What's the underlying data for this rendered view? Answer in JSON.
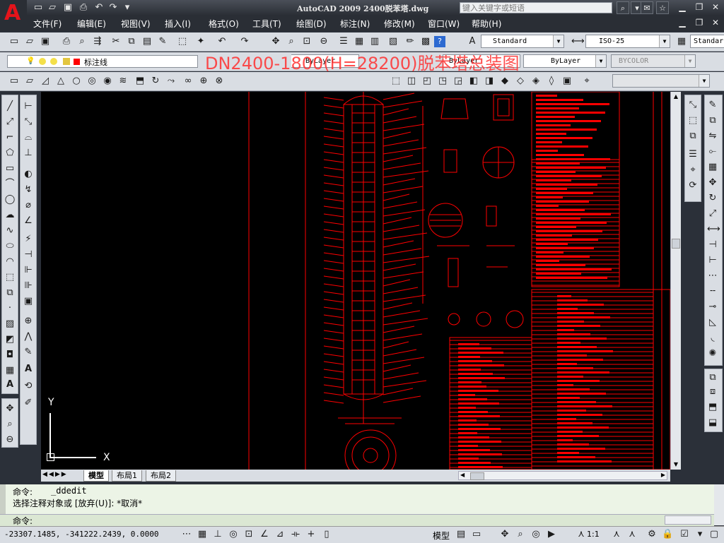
{
  "title_bar": {
    "window_title": "AutoCAD 2009  2400脱苯塔.dwg",
    "search_placeholder": "键入关键字或短语",
    "app_letter": "A",
    "brand_color": "#e4141b"
  },
  "menu": {
    "items": [
      "文件(F)",
      "编辑(E)",
      "视图(V)",
      "插入(I)",
      "格式(O)",
      "工具(T)",
      "绘图(D)",
      "标注(N)",
      "修改(M)",
      "窗口(W)",
      "帮助(H)"
    ]
  },
  "styles_toolbar": {
    "text_style": "Standard",
    "dim_style": "ISO-25",
    "table_style": "Standar"
  },
  "layers_toolbar": {
    "current_layer": "标注线",
    "layer_color": "#ff0000",
    "linetype": "ByLayer",
    "lineweight": "ByLayer",
    "plot_style": "BYCOLOR"
  },
  "drawing": {
    "overlay_title": "DN2400-1800(H=28200)脱苯塔总装图",
    "background": "#000000",
    "entity_color": "#ff0000",
    "ucs_x": "X",
    "ucs_y": "Y"
  },
  "layout_tabs": {
    "items": [
      "模型",
      "布局1",
      "布局2"
    ],
    "active": "模型"
  },
  "command": {
    "line1_prompt": "命令:",
    "line1_cmd": "_ddedit",
    "line2": "选择注释对象或 [放弃(U)]: *取消*",
    "input_prompt": "命令:"
  },
  "status": {
    "coordinates": "-23307.1485, -341222.2439, 0.0000",
    "space": "模型",
    "annotation_scale": "1:1"
  }
}
